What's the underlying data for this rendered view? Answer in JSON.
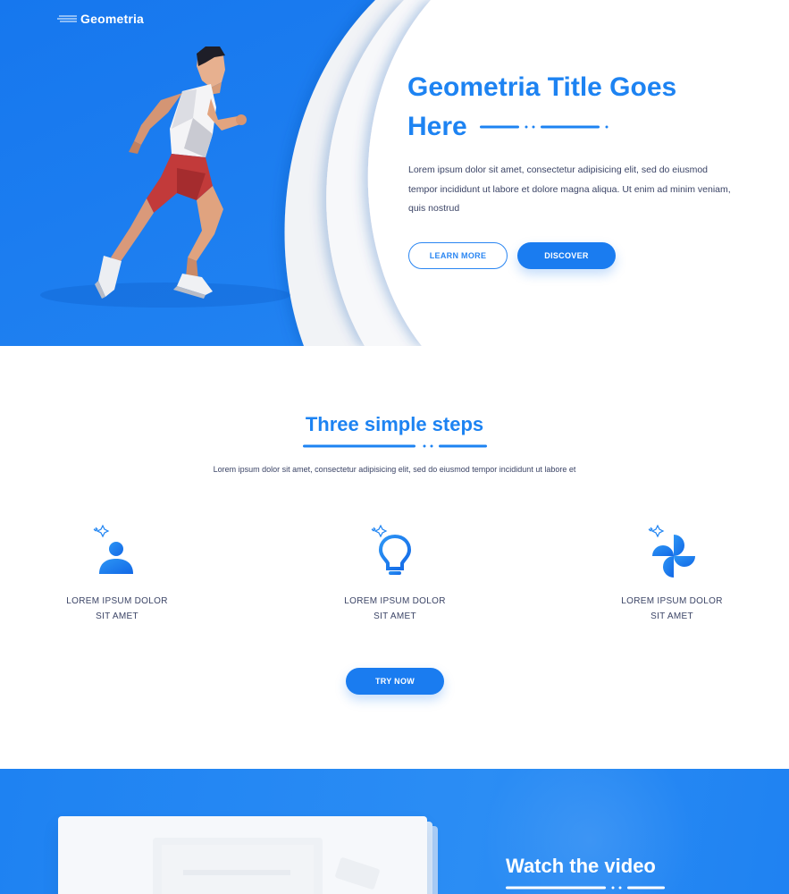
{
  "brand": {
    "name": "Geometria",
    "primary_color": "#1a7cf0",
    "accent_color": "#1d83f2",
    "logo_icon": "speed-lines-icon"
  },
  "hero": {
    "title_line1": "Geometria Title Goes",
    "title_line2": "Here",
    "text": "Lorem ipsum dolor sit amet, consectetur adipisicing elit, sed do eiusmod tempor incididunt ut labore et dolore magna aliqua. Ut enim ad minim veniam, quis nostrud",
    "learn_more_label": "LEARN MORE",
    "discover_label": "DISCOVER",
    "image": "low-poly-runner-illustration"
  },
  "steps": {
    "title": "Three simple steps",
    "subtitle": "Lorem ipsum dolor sit amet, consectetur adipisicing elit, sed do eiusmod tempor incididunt ut labore et",
    "items": [
      {
        "icon": "user-sparkle-icon",
        "line1": "LOREM IPSUM DOLOR",
        "line2": "SIT AMET"
      },
      {
        "icon": "lightbulb-sparkle-icon",
        "line1": "LOREM IPSUM DOLOR",
        "line2": "SIT AMET"
      },
      {
        "icon": "pinwheel-sparkle-icon",
        "line1": "LOREM IPSUM DOLOR",
        "line2": "SIT AMET"
      }
    ],
    "cta_label": "TRY NOW"
  },
  "video": {
    "title": "Watch the video"
  }
}
